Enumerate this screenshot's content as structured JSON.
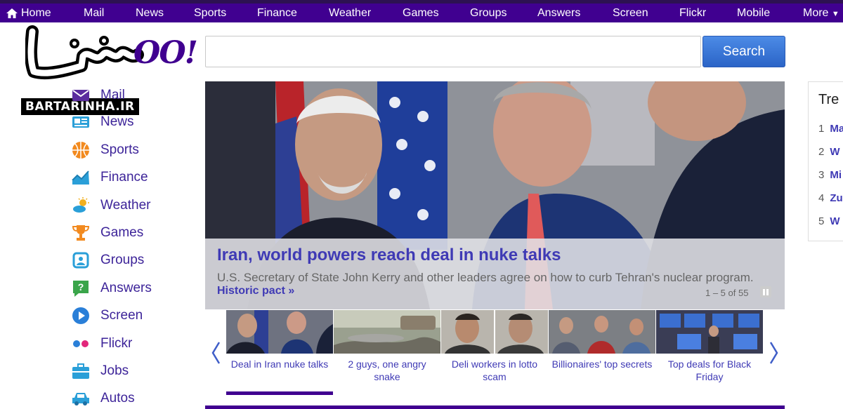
{
  "nav": {
    "items": [
      "Home",
      "Mail",
      "News",
      "Sports",
      "Finance",
      "Weather",
      "Games",
      "Groups",
      "Answers",
      "Screen",
      "Flickr",
      "Mobile",
      "More"
    ]
  },
  "logo": {
    "brand_text": "OO!",
    "watermark_text": "BARTARINHA.IR"
  },
  "search": {
    "value": "",
    "button_label": "Search"
  },
  "sidebar": {
    "items": [
      {
        "label": "Mail",
        "icon": "mail-icon",
        "color": "#5b2c9e"
      },
      {
        "label": "News",
        "icon": "news-icon",
        "color": "#2a9fd8"
      },
      {
        "label": "Sports",
        "icon": "sports-icon",
        "color": "#f28a1f"
      },
      {
        "label": "Finance",
        "icon": "finance-icon",
        "color": "#2a9fd8"
      },
      {
        "label": "Weather",
        "icon": "weather-icon",
        "color": "#2a9fd8"
      },
      {
        "label": "Games",
        "icon": "games-icon",
        "color": "#f28a1f"
      },
      {
        "label": "Groups",
        "icon": "groups-icon",
        "color": "#2a9fd8"
      },
      {
        "label": "Answers",
        "icon": "answers-icon",
        "color": "#3aa54a"
      },
      {
        "label": "Screen",
        "icon": "screen-icon",
        "color": "#2a9fd8"
      },
      {
        "label": "Flickr",
        "icon": "flickr-icon",
        "color": "#e2277b"
      },
      {
        "label": "Jobs",
        "icon": "jobs-icon",
        "color": "#2a9fd8"
      },
      {
        "label": "Autos",
        "icon": "autos-icon",
        "color": "#2a9fd8"
      }
    ]
  },
  "hero": {
    "title": "Iran, world powers reach deal in nuke talks",
    "description": "U.S. Secretary of State John Kerry and other leaders agree on how to curb Tehran's nuclear program.",
    "link": "Historic pact »",
    "count": "1 – 5 of 55"
  },
  "thumbnails": [
    {
      "label": "Deal in Iran nuke talks",
      "active": true
    },
    {
      "label": "2 guys, one angry snake",
      "active": false
    },
    {
      "label": "Deli workers in lotto scam",
      "active": false
    },
    {
      "label": "Billionaires' top secrets",
      "active": false
    },
    {
      "label": "Top deals for Black Friday",
      "active": false
    }
  ],
  "trending": {
    "title": "Tre",
    "items": [
      {
        "num": "1",
        "label": "Ma"
      },
      {
        "num": "2",
        "label": "W"
      },
      {
        "num": "3",
        "label": "Mi"
      },
      {
        "num": "4",
        "label": "Zu"
      },
      {
        "num": "5",
        "label": "W"
      }
    ]
  },
  "colors": {
    "nav_bg": "#400090",
    "link": "#3f3ab5",
    "search_button": "#3a76d8"
  }
}
